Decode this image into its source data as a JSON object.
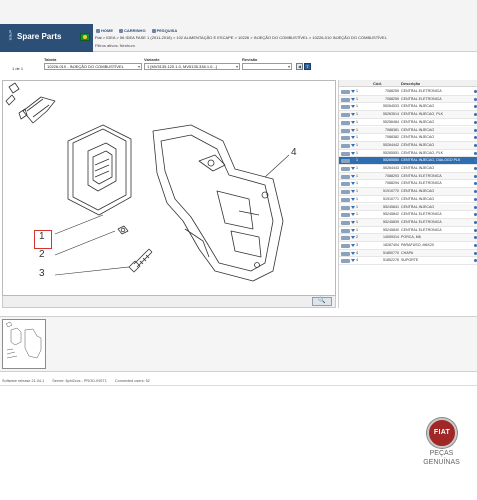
{
  "header": {
    "brand_logo_text": "ePER",
    "brand_title": "Spare Parts",
    "nav": [
      {
        "label": "HOME"
      },
      {
        "label": "CARRINHO"
      },
      {
        "label": "PESQUISA"
      }
    ],
    "breadcrumb": "Fiat > IDEA > 56 IDEA FASE 1 (2011-2016) > 102 ALIMENTAÇÃO E ESCAPE > 10226 > INJEÇÃO DO COMBUSTÍVEL > 10226-010 INJEÇÃO DO COMBUSTÍVEL",
    "hint": "Filtros ativos: Nenhum"
  },
  "selectors": {
    "page_info": "1 de 1",
    "tabela": {
      "label": "Tabela",
      "value": "10226-010 - INJEÇÃO DO COMBUSTÍVEL"
    },
    "variante": {
      "label": "Variante",
      "value": "1 [MV5135.120.1.0, MV5135.338.1.0...]"
    },
    "revisao": {
      "label": "Revisão",
      "value": ""
    },
    "buttons": [
      "◀",
      "T"
    ]
  },
  "drawing": {
    "callouts": [
      "1",
      "2",
      "3",
      "4"
    ]
  },
  "parts": {
    "headers": {
      "code": "Cód.",
      "desc": "Descrição"
    },
    "rows": [
      {
        "qty": "1",
        "code": "7088255",
        "desc": "CENTRAL ELETRONICA"
      },
      {
        "qty": "1",
        "code": "7088259",
        "desc": "CENTRAL ELETRONICA"
      },
      {
        "qty": "1",
        "code": "55264533",
        "desc": "CENTRAL INJECAO"
      },
      {
        "qty": "1",
        "code": "55263514",
        "desc": "CENTRAL INJECAO, PLK"
      },
      {
        "qty": "1",
        "code": "55256484",
        "desc": "CENTRAL INJECAO"
      },
      {
        "qty": "1",
        "code": "7088381",
        "desc": "CENTRAL INJECAO"
      },
      {
        "qty": "1",
        "code": "7088382",
        "desc": "CENTRAL INJECAO"
      },
      {
        "qty": "1",
        "code": "55264442",
        "desc": "CENTRAL INJECAO"
      },
      {
        "qty": "1",
        "code": "55265551",
        "desc": "CENTRAL INJECAO, PLK"
      },
      {
        "qty": "1",
        "code": "55265550",
        "desc": "CENTRAL INJECAO, DIALOGO PLK",
        "selected": true
      },
      {
        "qty": "1",
        "code": "55264443",
        "desc": "CENTRAL INJECAO"
      },
      {
        "qty": "1",
        "code": "7088293",
        "desc": "CENTRAL ELETRONICA"
      },
      {
        "qty": "1",
        "code": "7088294",
        "desc": "CENTRAL ELETRONICA"
      },
      {
        "qty": "1",
        "code": "51910770",
        "desc": "CENTRAL INJECAO"
      },
      {
        "qty": "1",
        "code": "51910771",
        "desc": "CENTRAL INJECAO"
      },
      {
        "qty": "1",
        "code": "55245841",
        "desc": "CENTRAL INJECAO"
      },
      {
        "qty": "1",
        "code": "55245842",
        "desc": "CENTRAL ELETRONICA"
      },
      {
        "qty": "1",
        "code": "55245839",
        "desc": "CENTRAL ELETRONICA"
      },
      {
        "qty": "1",
        "code": "55245840",
        "desc": "CENTRAL ELETRONICA"
      },
      {
        "qty": "2",
        "code": "14059314",
        "desc": "PORCA, M6"
      },
      {
        "qty": "3",
        "code": "16287404",
        "desc": "PARAFUSO, M6X20"
      },
      {
        "qty": "4",
        "code": "51850770",
        "desc": "CHAPA"
      },
      {
        "qty": "4",
        "code": "51852276",
        "desc": "SUPORTE"
      }
    ]
  },
  "status": {
    "items": [
      "Software release 21.04.1",
      "Server: 8phl2ccs - PROD-INST1",
      "Connected users: 52"
    ]
  },
  "badge": {
    "circle_text": "FIAT",
    "line1": "PEÇAS",
    "line2": "GENUÍNAS",
    "color": "#a12727"
  }
}
